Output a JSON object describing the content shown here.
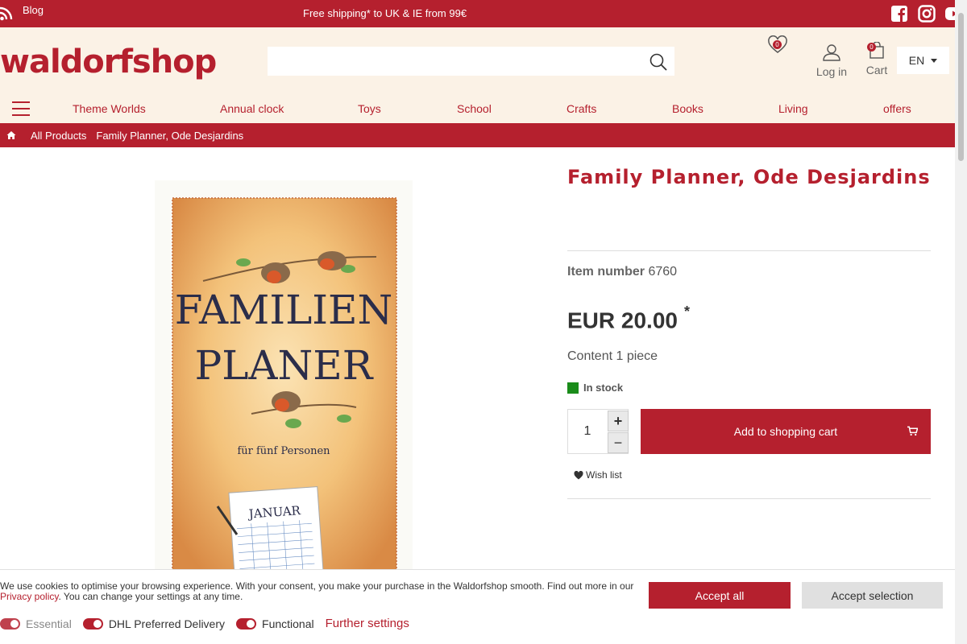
{
  "topbar": {
    "blog_label": "Blog",
    "promo": "Free shipping* to UK & IE from 99€",
    "social": [
      "facebook-icon",
      "instagram-icon",
      "youtube-icon"
    ]
  },
  "header": {
    "logo": "waldorfshop",
    "search_placeholder": "",
    "wishlist_count": "0",
    "login_label": "Log in",
    "cart_count": "0",
    "cart_label": "Cart",
    "language": "EN"
  },
  "nav": {
    "items": [
      "Theme Worlds",
      "Annual clock",
      "Toys",
      "School",
      "Crafts",
      "Books",
      "Living",
      "offers"
    ]
  },
  "breadcrumb": {
    "all_products": " All Products",
    "current": "Family Planner, Ode Desjardins"
  },
  "product": {
    "title": "Family Planner, Ode Desjardins",
    "item_number_label": "Item number",
    "item_number": "6760",
    "price": "EUR 20.00",
    "price_asterisk": "*",
    "content": "Content 1 piece",
    "stock": "In stock",
    "quantity": "1",
    "add_to_cart": "Add to shopping cart",
    "wishlist": "Wish list",
    "image_text": {
      "line1": "FAMILIEN",
      "line2": "PLANER",
      "line3": "für fünf Personen",
      "month": "JANUAR"
    }
  },
  "cookies": {
    "text_before": "We use cookies to optimise your browsing experience. With your consent, you make your purchase in the Waldorfshop smooth. Find out more in our ",
    "privacy_link": "Privacy policy",
    "text_after": ". You can change your settings at any time.",
    "accept_all": "Accept all",
    "accept_selection": "Accept selection",
    "toggles": [
      "Essential",
      "DHL Preferred Delivery",
      "Functional"
    ],
    "further_settings": "Further settings"
  },
  "colors": {
    "brand": "#b5202e",
    "header_bg": "#fbf2e6",
    "in_stock": "#1a8c1a"
  }
}
